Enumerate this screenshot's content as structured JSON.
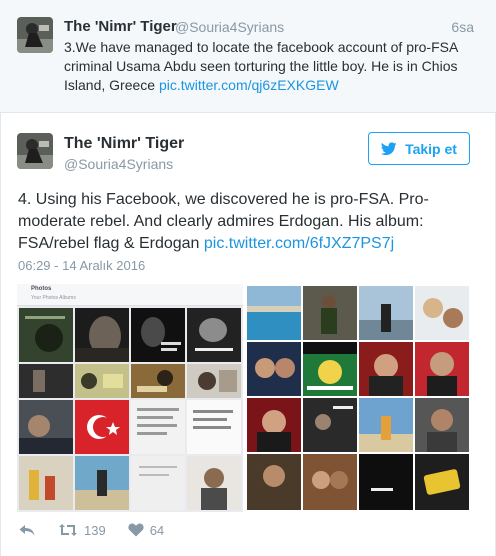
{
  "parent_tweet": {
    "name": "The 'Nimr' Tiger",
    "handle": "@Souria4Syrians",
    "time": "6sa",
    "text": "3.We have managed to locate the facebook account of pro-FSA criminal Usama Abdu seen torturing the little boy. He is in Chios Island, Greece ",
    "link": "pic.twitter.com/qj6zEXKGEW"
  },
  "main_tweet": {
    "name": "The 'Nimr' Tiger",
    "handle": "@Souria4Syrians",
    "follow_label": "Takip et",
    "text": "4. Using his Facebook, we discovered he is pro-FSA. Pro-moderate rebel. And clearly admires Erdogan. His album: FSA/rebel flag & Erdogan ",
    "link": "pic.twitter.com/6fJXZ7PS7j",
    "timestamp": "06:29 - 14 Aralık 2016"
  },
  "media": {
    "fb_title": "Photos",
    "fb_tabs": "Your Photos   Albums"
  },
  "actions": {
    "retweets": "139",
    "likes": "64"
  },
  "colors": {
    "accent": "#1da1f2",
    "link": "#1b95e0",
    "muted": "#8899a6",
    "text": "#292f33"
  }
}
